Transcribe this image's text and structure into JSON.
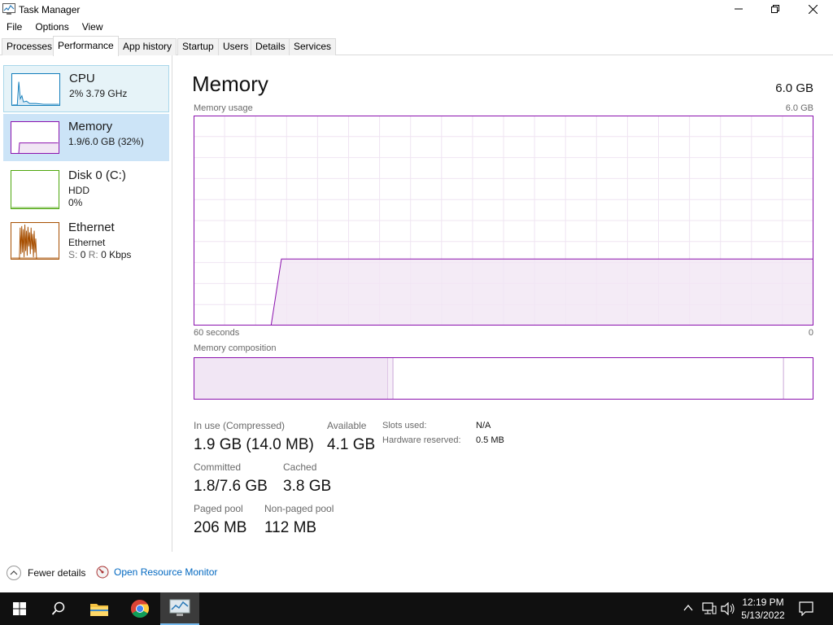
{
  "window": {
    "title": "Task Manager",
    "controls": [
      "minimize",
      "restore",
      "close"
    ]
  },
  "menu": [
    "File",
    "Options",
    "View"
  ],
  "tabs": [
    "Processes",
    "Performance",
    "App history",
    "Startup",
    "Users",
    "Details",
    "Services"
  ],
  "active_tab": "Performance",
  "sidebar": {
    "items": [
      {
        "name": "CPU",
        "line1": "2%  3.79 GHz",
        "line2": "",
        "color": "#117dbb"
      },
      {
        "name": "Memory",
        "line1": "1.9/6.0 GB (32%)",
        "line2": "",
        "color": "#8b12ae"
      },
      {
        "name": "Disk 0 (C:)",
        "line1": "HDD",
        "line2": "0%",
        "color": "#4da60c"
      },
      {
        "name": "Ethernet",
        "line1": "Ethernet",
        "line2_prefix_s": "S:",
        "line2_s": "0",
        "line2_prefix_r": "R:",
        "line2_r": "0 Kbps",
        "color": "#a74f01"
      }
    ],
    "selected": "Memory"
  },
  "main": {
    "title": "Memory",
    "total": "6.0 GB",
    "usage_label": "Memory usage",
    "usage_max": "6.0 GB",
    "time_left": "60 seconds",
    "time_right": "0",
    "composition_label": "Memory composition",
    "accent": "#8b12ae",
    "stats": {
      "in_use_label": "In use (Compressed)",
      "in_use_value": "1.9 GB (14.0 MB)",
      "available_label": "Available",
      "available_value": "4.1 GB",
      "committed_label": "Committed",
      "committed_value": "1.8/7.6 GB",
      "cached_label": "Cached",
      "cached_value": "3.8 GB",
      "paged_label": "Paged pool",
      "paged_value": "206 MB",
      "nonpaged_label": "Non-paged pool",
      "nonpaged_value": "112 MB",
      "slots_label": "Slots used:",
      "slots_value": "N/A",
      "hwres_label": "Hardware reserved:",
      "hwres_value": "0.5 MB"
    }
  },
  "chart_data": {
    "type": "area",
    "title": "Memory usage",
    "xlabel": "",
    "ylabel": "",
    "x_range": [
      "60 seconds",
      "0"
    ],
    "ylim": [
      0,
      6.0
    ],
    "units": "GB",
    "grid": true,
    "x": [
      60,
      52.5,
      51.5,
      49,
      45,
      40,
      30,
      20,
      15,
      10,
      5,
      0
    ],
    "values": [
      0,
      0,
      1.9,
      1.9,
      1.9,
      1.9,
      1.9,
      1.9,
      1.9,
      1.9,
      1.9,
      1.9
    ],
    "composition": {
      "in_use_fraction": 0.32,
      "modified_fraction": 0.01,
      "standby_fraction": 0.63,
      "free_fraction": 0.05
    }
  },
  "footer": {
    "fewer_details": "Fewer details",
    "open_resource_monitor": "Open Resource Monitor"
  },
  "taskbar": {
    "time": "12:19 PM",
    "date": "5/13/2022"
  }
}
